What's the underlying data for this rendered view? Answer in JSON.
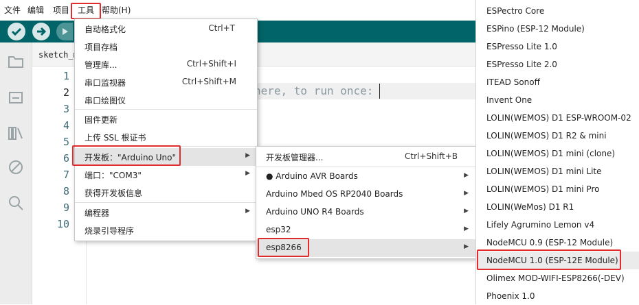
{
  "menubar": {
    "items": [
      "文件",
      "编辑",
      "项目",
      "工具",
      "帮助(H)"
    ]
  },
  "toolbar": {
    "verify_icon": "check-icon",
    "upload_icon": "arrow-right-icon",
    "debug_icon": "debug-icon"
  },
  "sidebar": {
    "icons": [
      "folder-icon",
      "board-icon",
      "library-icon",
      "debug-icon",
      "search-icon"
    ]
  },
  "editor": {
    "tab_label": "sketch_m",
    "line_numbers": [
      "1",
      "2",
      "3",
      "4",
      "5",
      "6",
      "7",
      "8",
      "9",
      "10"
    ],
    "code_visible": "here, to run once:"
  },
  "tools_menu": {
    "items": [
      {
        "label": "自动格式化",
        "shortcut": "Ctrl+T"
      },
      {
        "label": "项目存档",
        "shortcut": ""
      },
      {
        "label": "管理库...",
        "shortcut": "Ctrl+Shift+I"
      },
      {
        "label": "串口监视器",
        "shortcut": "Ctrl+Shift+M"
      },
      {
        "label": "串口绘图仪",
        "shortcut": ""
      },
      {
        "label": "固件更新",
        "shortcut": ""
      },
      {
        "label": "上传 SSL 根证书",
        "shortcut": ""
      },
      {
        "label": "开发板：\"Arduino Uno\"",
        "shortcut": ""
      },
      {
        "label": "端口：\"COM3\"",
        "shortcut": ""
      },
      {
        "label": "获得开发板信息",
        "shortcut": ""
      },
      {
        "label": "编程器",
        "shortcut": ""
      },
      {
        "label": "烧录引导程序",
        "shortcut": ""
      }
    ]
  },
  "board_menu": {
    "items": [
      {
        "label": "开发板管理器...",
        "shortcut": "Ctrl+Shift+B"
      },
      {
        "label": "● Arduino AVR Boards",
        "shortcut": ""
      },
      {
        "label": "Arduino Mbed OS RP2040 Boards",
        "shortcut": ""
      },
      {
        "label": "Arduino UNO R4 Boards",
        "shortcut": ""
      },
      {
        "label": "esp32",
        "shortcut": ""
      },
      {
        "label": "esp8266",
        "shortcut": ""
      }
    ]
  },
  "esp8266_boards": {
    "items": [
      "ESPectro Core",
      "ESPino (ESP-12 Module)",
      "ESPresso Lite 1.0",
      "ESPresso Lite 2.0",
      "ITEAD Sonoff",
      "Invent One",
      "LOLIN(WEMOS) D1 ESP-WROOM-02",
      "LOLIN(WEMOS) D1 R2 & mini",
      "LOLIN(WEMOS) D1 mini (clone)",
      "LOLIN(WEMOS) D1 mini Lite",
      "LOLIN(WEMOS) D1 mini Pro",
      "LOLIN(WeMos) D1 R1",
      "Lifely Agrumino Lemon v4",
      "NodeMCU 0.9 (ESP-12 Module)",
      "NodeMCU 1.0 (ESP-12E Module)",
      "Olimex MOD-WIFI-ESP8266(-DEV)",
      "Phoenix 1.0"
    ],
    "selected": "NodeMCU 1.0 (ESP-12E Module)"
  },
  "colors": {
    "toolbar_bg": "#006468",
    "highlight_box": "#e02c2c",
    "menu_hover": "#e4e4e4"
  }
}
